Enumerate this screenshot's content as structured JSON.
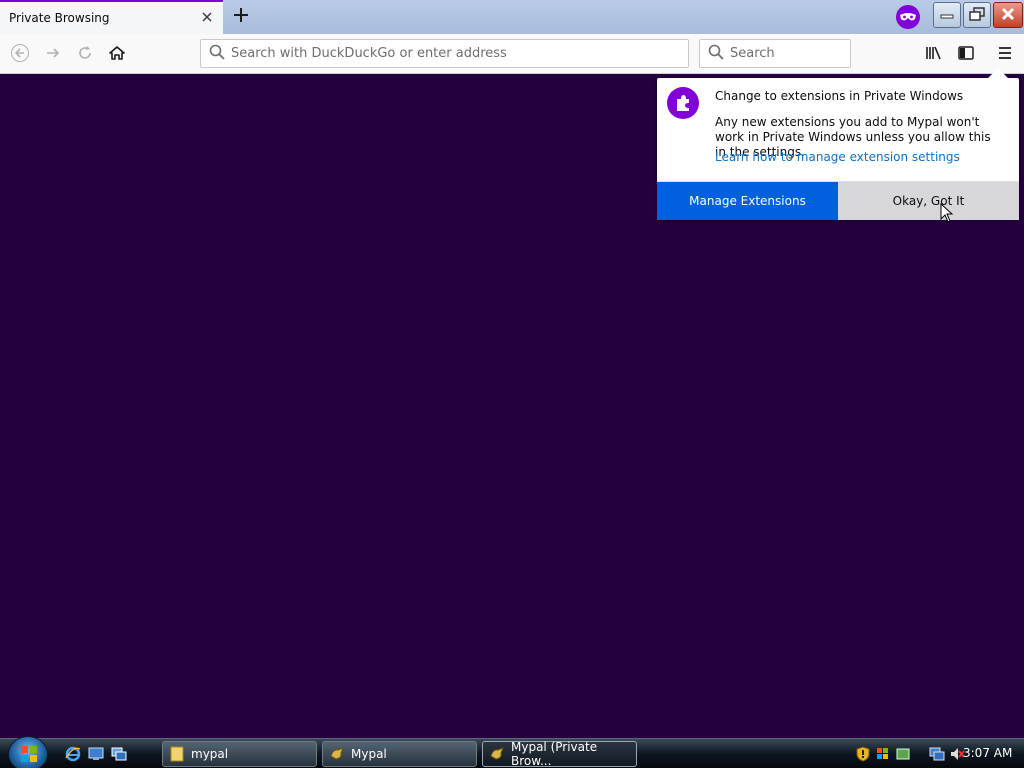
{
  "tab": {
    "title": "Private Browsing"
  },
  "navbar": {
    "url_placeholder": "Search with DuckDuckGo or enter address",
    "search_placeholder": "Search"
  },
  "popup": {
    "title": "Change to extensions in Private Windows",
    "body": "Any new extensions you add to Mypal won't work in Private Windows unless you allow this in the settings.",
    "link": "Learn how to manage extension settings",
    "primary_button": "Manage Extensions",
    "secondary_button": "Okay, Got It"
  },
  "taskbar": {
    "tasks": [
      {
        "label": "mypal"
      },
      {
        "label": "Mypal"
      },
      {
        "label": "Mypal (Private Brow..."
      }
    ],
    "clock": "3:07 AM"
  },
  "colors": {
    "page_background": "#25003e",
    "private_accent": "#8000d7",
    "primary_button": "#0060df",
    "link": "#0a72c5"
  },
  "icons": [
    "close-icon",
    "plus-icon",
    "private-mask-icon",
    "minimize-icon",
    "restore-icon",
    "back-arrow-icon",
    "forward-arrow-icon",
    "reload-icon",
    "home-icon",
    "search-icon",
    "library-icon",
    "sidebar-icon",
    "hamburger-menu-icon",
    "puzzle-icon",
    "windows-start-icon",
    "ie-icon",
    "show-desktop-icon",
    "switch-windows-icon",
    "folder-icon",
    "mypal-icon",
    "shield-icon",
    "network-icon",
    "volume-muted-icon"
  ]
}
